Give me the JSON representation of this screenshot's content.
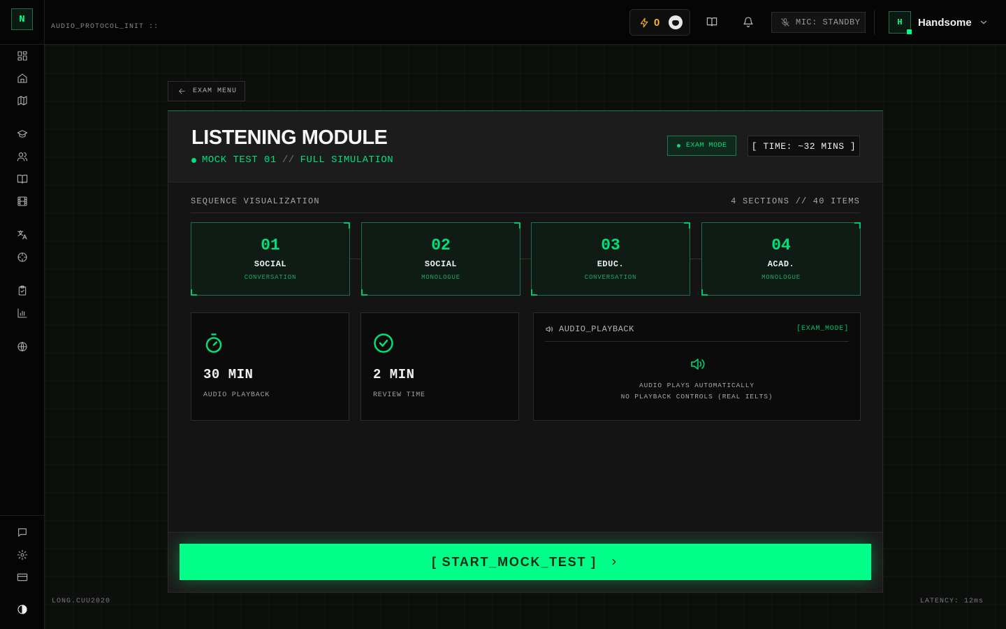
{
  "app": {
    "logo_letter": "N",
    "protocol_label": "AUDIO_PROTOCOL_INIT ::",
    "footer_left": "LONG.CUU2020",
    "footer_right": "LATENCY: 12ms",
    "accent": "#00ff88"
  },
  "sidebar": {
    "items": [
      {
        "icon": "dashboard-icon"
      },
      {
        "icon": "home-icon"
      },
      {
        "icon": "map-icon"
      },
      {
        "icon": "graduation-cap-icon"
      },
      {
        "icon": "users-icon"
      },
      {
        "icon": "book-icon"
      },
      {
        "icon": "film-icon"
      },
      {
        "icon": "translate-icon"
      },
      {
        "icon": "crosshair-icon"
      },
      {
        "icon": "clipboard-icon"
      },
      {
        "icon": "bar-chart-icon"
      },
      {
        "icon": "globe-icon"
      }
    ],
    "bottom_items": [
      {
        "icon": "message-icon"
      },
      {
        "icon": "settings-icon"
      },
      {
        "icon": "credit-card-icon"
      },
      {
        "icon": "theme-toggle-icon"
      }
    ]
  },
  "header": {
    "energy_count": "0",
    "mic_status": "MIC: STANDBY",
    "user": {
      "initial": "H",
      "name": "Handsome"
    }
  },
  "nav": {
    "back_label": "EXAM MENU"
  },
  "module": {
    "title": "LISTENING MODULE",
    "subtitle_test": "MOCK TEST 01",
    "subtitle_sep": "//",
    "subtitle_mode": "FULL SIMULATION",
    "exam_badge": "EXAM MODE",
    "time_badge": "[ TIME: ~32 MINS ]"
  },
  "sequence": {
    "label": "SEQUENCE VISUALIZATION",
    "count": "4 SECTIONS // 40 ITEMS",
    "sections": [
      {
        "num": "01",
        "name": "SOCIAL",
        "type": "CONVERSATION"
      },
      {
        "num": "02",
        "name": "SOCIAL",
        "type": "MONOLOGUE"
      },
      {
        "num": "03",
        "name": "EDUC.",
        "type": "CONVERSATION"
      },
      {
        "num": "04",
        "name": "ACAD.",
        "type": "MONOLOGUE"
      }
    ]
  },
  "stats": [
    {
      "value": "30 MIN",
      "label": "AUDIO PLAYBACK",
      "icon": "timer-icon"
    },
    {
      "value": "2 MIN",
      "label": "REVIEW TIME",
      "icon": "check-circle-icon"
    }
  ],
  "audio": {
    "title": "AUDIO_PLAYBACK",
    "tag": "[EXAM_MODE]",
    "line1": "AUDIO PLAYS AUTOMATICALLY",
    "line2": "NO PLAYBACK CONTROLS (REAL IELTS)"
  },
  "cta": {
    "label": "[ START_MOCK_TEST ]"
  }
}
